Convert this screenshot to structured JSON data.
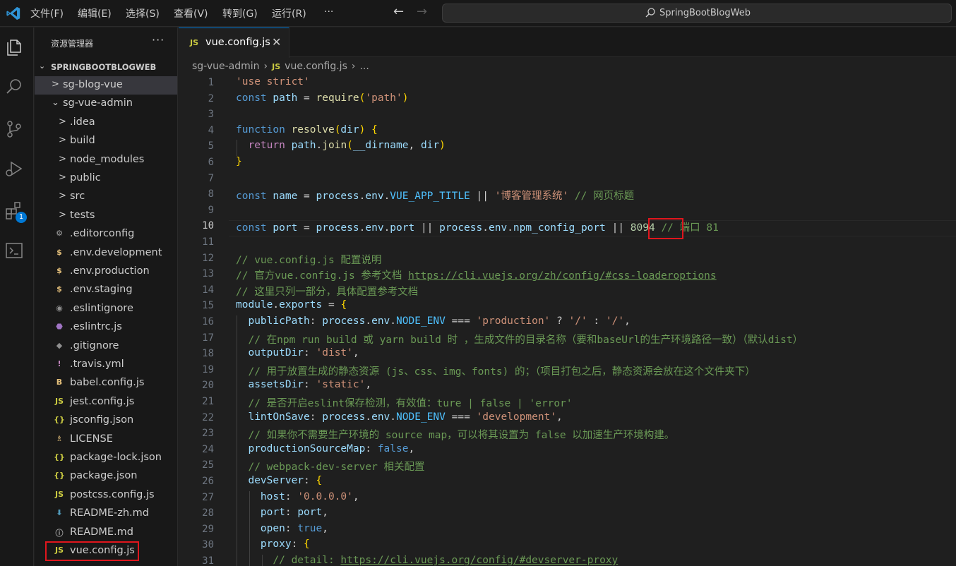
{
  "menu": {
    "file": "文件(F)",
    "edit": "编辑(E)",
    "selection": "选择(S)",
    "view": "查看(V)",
    "go": "转到(G)",
    "run": "运行(R)",
    "more": "···"
  },
  "search": {
    "text": "SpringBootBlogWeb"
  },
  "activity": {
    "extensions_badge": "1"
  },
  "sidebar": {
    "title": "资源管理器",
    "more": "···",
    "workspace": "SPRINGBOOTBLOGWEB",
    "items": [
      {
        "label": "sg-blog-vue",
        "icon": "folder-chevron",
        "glyph": ">"
      },
      {
        "label": "sg-vue-admin",
        "icon": "folder-open-chevron",
        "glyph": "⌄"
      },
      {
        "label": ".idea",
        "icon": "folder-chevron",
        "glyph": ">"
      },
      {
        "label": "build",
        "icon": "folder-chevron",
        "glyph": ">"
      },
      {
        "label": "node_modules",
        "icon": "folder-chevron",
        "glyph": ">"
      },
      {
        "label": "public",
        "icon": "folder-chevron",
        "glyph": ">"
      },
      {
        "label": "src",
        "icon": "folder-chevron",
        "glyph": ">"
      },
      {
        "label": "tests",
        "icon": "folder-chevron",
        "glyph": ">"
      },
      {
        "label": ".editorconfig",
        "icon": "gear-icon",
        "glyph": "⚙"
      },
      {
        "label": ".env.development",
        "icon": "dollar-icon",
        "glyph": "$"
      },
      {
        "label": ".env.production",
        "icon": "dollar-icon",
        "glyph": "$"
      },
      {
        "label": ".env.staging",
        "icon": "dollar-icon",
        "glyph": "$"
      },
      {
        "label": ".eslintignore",
        "icon": "circle-icon",
        "glyph": "◉"
      },
      {
        "label": ".eslintrc.js",
        "icon": "eslint-icon",
        "glyph": "⬣"
      },
      {
        "label": ".gitignore",
        "icon": "git-icon",
        "glyph": "◆"
      },
      {
        "label": ".travis.yml",
        "icon": "exclamation-icon",
        "glyph": "!"
      },
      {
        "label": "babel.config.js",
        "icon": "babel-icon",
        "glyph": "B"
      },
      {
        "label": "jest.config.js",
        "icon": "js-icon",
        "glyph": "JS"
      },
      {
        "label": "jsconfig.json",
        "icon": "json-icon",
        "glyph": "{}"
      },
      {
        "label": "LICENSE",
        "icon": "license-icon",
        "glyph": "♗"
      },
      {
        "label": "package-lock.json",
        "icon": "json-icon",
        "glyph": "{}"
      },
      {
        "label": "package.json",
        "icon": "json-icon",
        "glyph": "{}"
      },
      {
        "label": "postcss.config.js",
        "icon": "js-icon",
        "glyph": "JS"
      },
      {
        "label": "README-zh.md",
        "icon": "markdown-icon",
        "glyph": "⬇"
      },
      {
        "label": "README.md",
        "icon": "info-icon",
        "glyph": "ⓘ"
      },
      {
        "label": "vue.config.js",
        "icon": "js-icon",
        "glyph": "JS"
      }
    ]
  },
  "tab": {
    "icon": "JS",
    "label": "vue.config.js",
    "close": "✕"
  },
  "breadcrumb": {
    "folder": "sg-vue-admin",
    "icon": "JS",
    "file": "vue.config.js",
    "rest": "..."
  },
  "editor": {
    "current_line": "10",
    "line_numbers": [
      "1",
      "2",
      "3",
      "4",
      "5",
      "6",
      "7",
      "8",
      "9",
      "10",
      "11",
      "12",
      "13",
      "14",
      "15",
      "16",
      "17",
      "18",
      "19",
      "20",
      "21",
      "22",
      "23",
      "24",
      "25",
      "26",
      "27",
      "28",
      "29",
      "30",
      "31"
    ],
    "lines": [
      "'use strict'",
      "const path = require('path')",
      "",
      "function resolve(dir) {",
      "  return path.join(__dirname, dir)",
      "}",
      "",
      "const name = process.env.VUE_APP_TITLE || '博客管理系统' // 网页标题",
      "",
      "const port = process.env.port || process.env.npm_config_port || 8094 // 端口 81",
      "",
      "// vue.config.js 配置说明",
      "// 官方vue.config.js 参考文档 https://cli.vuejs.org/zh/config/#css-loaderoptions",
      "// 这里只列一部分，具体配置参考文档",
      "module.exports = {",
      "  publicPath: process.env.NODE_ENV === 'production' ? '/' : '/',",
      "  // 在npm run build 或 yarn build 时 ，生成文件的目录名称（要和baseUrl的生产环境路径一致）（默认dist）",
      "  outputDir: 'dist',",
      "  // 用于放置生成的静态资源 (js、css、img、fonts) 的；（项目打包之后，静态资源会放在这个文件夹下）",
      "  assetsDir: 'static',",
      "  // 是否开启eslint保存检测，有效值：ture | false | 'error'",
      "  lintOnSave: process.env.NODE_ENV === 'development',",
      "  // 如果你不需要生产环境的 source map，可以将其设置为 false 以加速生产环境构建。",
      "  productionSourceMap: false,",
      "  // webpack-dev-server 相关配置",
      "  devServer: {",
      "    host: '0.0.0.0',",
      "    port: port,",
      "    open: true,",
      "    proxy: {",
      "      // detail: https://cli.vuejs.org/config/#devserver-proxy"
    ]
  },
  "colors": {
    "accent": "#0078d4",
    "highlight_box": "#e0161d",
    "keyword": "#569cd6",
    "string": "#ce9178",
    "comment": "#6a9955",
    "function": "#dcdcaa",
    "variable": "#9cdcfe"
  }
}
